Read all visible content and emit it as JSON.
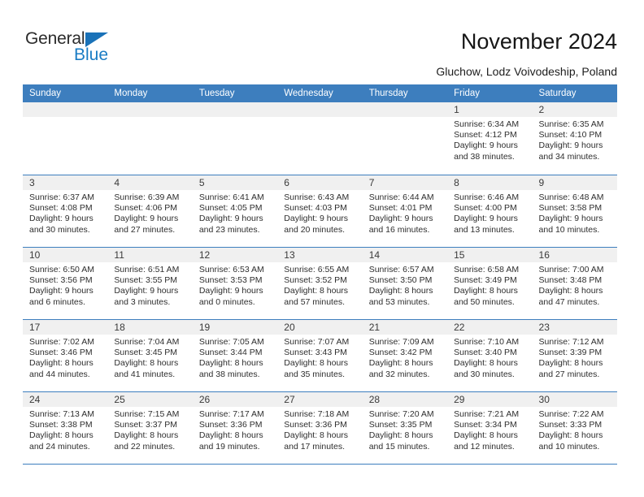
{
  "logo": {
    "text_primary": "General",
    "text_secondary": "Blue",
    "triangle_color": "#1a72b8",
    "secondary_color": "#1a7cc4"
  },
  "header": {
    "title": "November 2024",
    "subtitle": "Gluchow, Lodz Voivodeship, Poland"
  },
  "theme": {
    "accent": "#3d7ebe",
    "date_band": "#f0f0f0",
    "text": "#2e2e2e"
  },
  "calendar": {
    "weekday_headers": [
      "Sunday",
      "Monday",
      "Tuesday",
      "Wednesday",
      "Thursday",
      "Friday",
      "Saturday"
    ],
    "weeks": [
      [
        {
          "date": "",
          "sunrise": "",
          "sunset": "",
          "daylight_line1": "",
          "daylight_line2": "",
          "empty": true
        },
        {
          "date": "",
          "sunrise": "",
          "sunset": "",
          "daylight_line1": "",
          "daylight_line2": "",
          "empty": true
        },
        {
          "date": "",
          "sunrise": "",
          "sunset": "",
          "daylight_line1": "",
          "daylight_line2": "",
          "empty": true
        },
        {
          "date": "",
          "sunrise": "",
          "sunset": "",
          "daylight_line1": "",
          "daylight_line2": "",
          "empty": true
        },
        {
          "date": "",
          "sunrise": "",
          "sunset": "",
          "daylight_line1": "",
          "daylight_line2": "",
          "empty": true
        },
        {
          "date": "1",
          "sunrise": "Sunrise: 6:34 AM",
          "sunset": "Sunset: 4:12 PM",
          "daylight_line1": "Daylight: 9 hours",
          "daylight_line2": "and 38 minutes.",
          "empty": false
        },
        {
          "date": "2",
          "sunrise": "Sunrise: 6:35 AM",
          "sunset": "Sunset: 4:10 PM",
          "daylight_line1": "Daylight: 9 hours",
          "daylight_line2": "and 34 minutes.",
          "empty": false
        }
      ],
      [
        {
          "date": "3",
          "sunrise": "Sunrise: 6:37 AM",
          "sunset": "Sunset: 4:08 PM",
          "daylight_line1": "Daylight: 9 hours",
          "daylight_line2": "and 30 minutes.",
          "empty": false
        },
        {
          "date": "4",
          "sunrise": "Sunrise: 6:39 AM",
          "sunset": "Sunset: 4:06 PM",
          "daylight_line1": "Daylight: 9 hours",
          "daylight_line2": "and 27 minutes.",
          "empty": false
        },
        {
          "date": "5",
          "sunrise": "Sunrise: 6:41 AM",
          "sunset": "Sunset: 4:05 PM",
          "daylight_line1": "Daylight: 9 hours",
          "daylight_line2": "and 23 minutes.",
          "empty": false
        },
        {
          "date": "6",
          "sunrise": "Sunrise: 6:43 AM",
          "sunset": "Sunset: 4:03 PM",
          "daylight_line1": "Daylight: 9 hours",
          "daylight_line2": "and 20 minutes.",
          "empty": false
        },
        {
          "date": "7",
          "sunrise": "Sunrise: 6:44 AM",
          "sunset": "Sunset: 4:01 PM",
          "daylight_line1": "Daylight: 9 hours",
          "daylight_line2": "and 16 minutes.",
          "empty": false
        },
        {
          "date": "8",
          "sunrise": "Sunrise: 6:46 AM",
          "sunset": "Sunset: 4:00 PM",
          "daylight_line1": "Daylight: 9 hours",
          "daylight_line2": "and 13 minutes.",
          "empty": false
        },
        {
          "date": "9",
          "sunrise": "Sunrise: 6:48 AM",
          "sunset": "Sunset: 3:58 PM",
          "daylight_line1": "Daylight: 9 hours",
          "daylight_line2": "and 10 minutes.",
          "empty": false
        }
      ],
      [
        {
          "date": "10",
          "sunrise": "Sunrise: 6:50 AM",
          "sunset": "Sunset: 3:56 PM",
          "daylight_line1": "Daylight: 9 hours",
          "daylight_line2": "and 6 minutes.",
          "empty": false
        },
        {
          "date": "11",
          "sunrise": "Sunrise: 6:51 AM",
          "sunset": "Sunset: 3:55 PM",
          "daylight_line1": "Daylight: 9 hours",
          "daylight_line2": "and 3 minutes.",
          "empty": false
        },
        {
          "date": "12",
          "sunrise": "Sunrise: 6:53 AM",
          "sunset": "Sunset: 3:53 PM",
          "daylight_line1": "Daylight: 9 hours",
          "daylight_line2": "and 0 minutes.",
          "empty": false
        },
        {
          "date": "13",
          "sunrise": "Sunrise: 6:55 AM",
          "sunset": "Sunset: 3:52 PM",
          "daylight_line1": "Daylight: 8 hours",
          "daylight_line2": "and 57 minutes.",
          "empty": false
        },
        {
          "date": "14",
          "sunrise": "Sunrise: 6:57 AM",
          "sunset": "Sunset: 3:50 PM",
          "daylight_line1": "Daylight: 8 hours",
          "daylight_line2": "and 53 minutes.",
          "empty": false
        },
        {
          "date": "15",
          "sunrise": "Sunrise: 6:58 AM",
          "sunset": "Sunset: 3:49 PM",
          "daylight_line1": "Daylight: 8 hours",
          "daylight_line2": "and 50 minutes.",
          "empty": false
        },
        {
          "date": "16",
          "sunrise": "Sunrise: 7:00 AM",
          "sunset": "Sunset: 3:48 PM",
          "daylight_line1": "Daylight: 8 hours",
          "daylight_line2": "and 47 minutes.",
          "empty": false
        }
      ],
      [
        {
          "date": "17",
          "sunrise": "Sunrise: 7:02 AM",
          "sunset": "Sunset: 3:46 PM",
          "daylight_line1": "Daylight: 8 hours",
          "daylight_line2": "and 44 minutes.",
          "empty": false
        },
        {
          "date": "18",
          "sunrise": "Sunrise: 7:04 AM",
          "sunset": "Sunset: 3:45 PM",
          "daylight_line1": "Daylight: 8 hours",
          "daylight_line2": "and 41 minutes.",
          "empty": false
        },
        {
          "date": "19",
          "sunrise": "Sunrise: 7:05 AM",
          "sunset": "Sunset: 3:44 PM",
          "daylight_line1": "Daylight: 8 hours",
          "daylight_line2": "and 38 minutes.",
          "empty": false
        },
        {
          "date": "20",
          "sunrise": "Sunrise: 7:07 AM",
          "sunset": "Sunset: 3:43 PM",
          "daylight_line1": "Daylight: 8 hours",
          "daylight_line2": "and 35 minutes.",
          "empty": false
        },
        {
          "date": "21",
          "sunrise": "Sunrise: 7:09 AM",
          "sunset": "Sunset: 3:42 PM",
          "daylight_line1": "Daylight: 8 hours",
          "daylight_line2": "and 32 minutes.",
          "empty": false
        },
        {
          "date": "22",
          "sunrise": "Sunrise: 7:10 AM",
          "sunset": "Sunset: 3:40 PM",
          "daylight_line1": "Daylight: 8 hours",
          "daylight_line2": "and 30 minutes.",
          "empty": false
        },
        {
          "date": "23",
          "sunrise": "Sunrise: 7:12 AM",
          "sunset": "Sunset: 3:39 PM",
          "daylight_line1": "Daylight: 8 hours",
          "daylight_line2": "and 27 minutes.",
          "empty": false
        }
      ],
      [
        {
          "date": "24",
          "sunrise": "Sunrise: 7:13 AM",
          "sunset": "Sunset: 3:38 PM",
          "daylight_line1": "Daylight: 8 hours",
          "daylight_line2": "and 24 minutes.",
          "empty": false
        },
        {
          "date": "25",
          "sunrise": "Sunrise: 7:15 AM",
          "sunset": "Sunset: 3:37 PM",
          "daylight_line1": "Daylight: 8 hours",
          "daylight_line2": "and 22 minutes.",
          "empty": false
        },
        {
          "date": "26",
          "sunrise": "Sunrise: 7:17 AM",
          "sunset": "Sunset: 3:36 PM",
          "daylight_line1": "Daylight: 8 hours",
          "daylight_line2": "and 19 minutes.",
          "empty": false
        },
        {
          "date": "27",
          "sunrise": "Sunrise: 7:18 AM",
          "sunset": "Sunset: 3:36 PM",
          "daylight_line1": "Daylight: 8 hours",
          "daylight_line2": "and 17 minutes.",
          "empty": false
        },
        {
          "date": "28",
          "sunrise": "Sunrise: 7:20 AM",
          "sunset": "Sunset: 3:35 PM",
          "daylight_line1": "Daylight: 8 hours",
          "daylight_line2": "and 15 minutes.",
          "empty": false
        },
        {
          "date": "29",
          "sunrise": "Sunrise: 7:21 AM",
          "sunset": "Sunset: 3:34 PM",
          "daylight_line1": "Daylight: 8 hours",
          "daylight_line2": "and 12 minutes.",
          "empty": false
        },
        {
          "date": "30",
          "sunrise": "Sunrise: 7:22 AM",
          "sunset": "Sunset: 3:33 PM",
          "daylight_line1": "Daylight: 8 hours",
          "daylight_line2": "and 10 minutes.",
          "empty": false
        }
      ]
    ]
  }
}
